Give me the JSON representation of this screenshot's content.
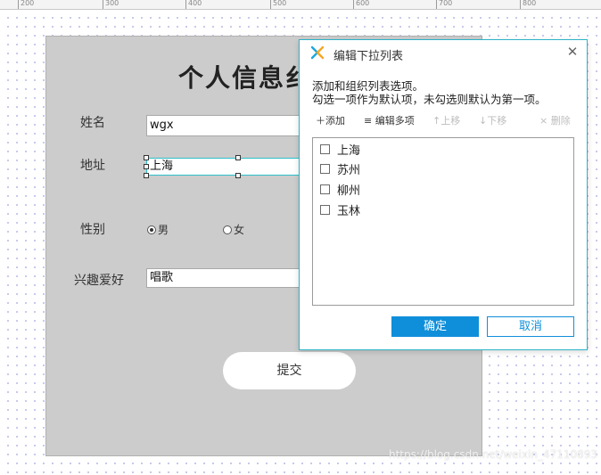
{
  "ruler": {
    "labels": [
      "200",
      "300",
      "400",
      "500",
      "600",
      "700",
      "800"
    ]
  },
  "form": {
    "title": "个人信息纟",
    "name_label": "姓名",
    "name_value": "wgx",
    "address_label": "地址",
    "address_value": "上海",
    "gender_label": "性别",
    "gender_options": [
      "男",
      "女"
    ],
    "gender_selected": "男",
    "hobby_label": "兴趣爱好",
    "hobby_value": "唱歌",
    "submit_label": "提交"
  },
  "dialog": {
    "title": "编辑下拉列表",
    "description_line1": "添加和组织列表选项。",
    "description_line2": "勾选一项作为默认项，未勾选则默认为第一项。",
    "toolbar": {
      "add": "＋添加",
      "edit_multi": "≡ 编辑多项",
      "move_up": "↑上移",
      "move_down": "↓下移",
      "delete": "× 删除"
    },
    "items": [
      {
        "label": "上海",
        "checked": false
      },
      {
        "label": "苏州",
        "checked": false
      },
      {
        "label": "柳州",
        "checked": false
      },
      {
        "label": "玉林",
        "checked": false
      }
    ],
    "ok_label": "确定",
    "cancel_label": "取消"
  },
  "watermark": "https://blog.csdn.net/weixin_47110893",
  "colors": {
    "accent": "#0f8fda",
    "selection": "#2cc0c9",
    "form_bg": "#cccccc",
    "logo": "#1aa7e0"
  }
}
